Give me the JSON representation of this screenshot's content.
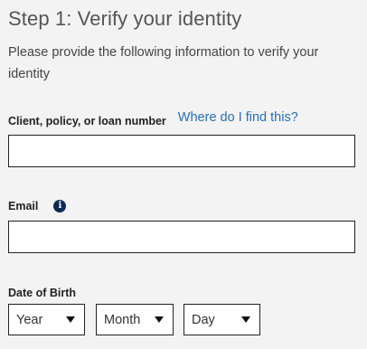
{
  "step_title": "Step 1: Verify your identity",
  "intro_text": "Please provide the following information to verify your identity",
  "client_field": {
    "label": "Client, policy, or loan number",
    "help_link": "Where do I find this?",
    "value": "",
    "placeholder": ""
  },
  "email_field": {
    "label": "Email",
    "info_icon": "i",
    "value": "",
    "placeholder": ""
  },
  "dob": {
    "label": "Date of Birth",
    "year": "Year",
    "month": "Month",
    "day": "Day"
  }
}
